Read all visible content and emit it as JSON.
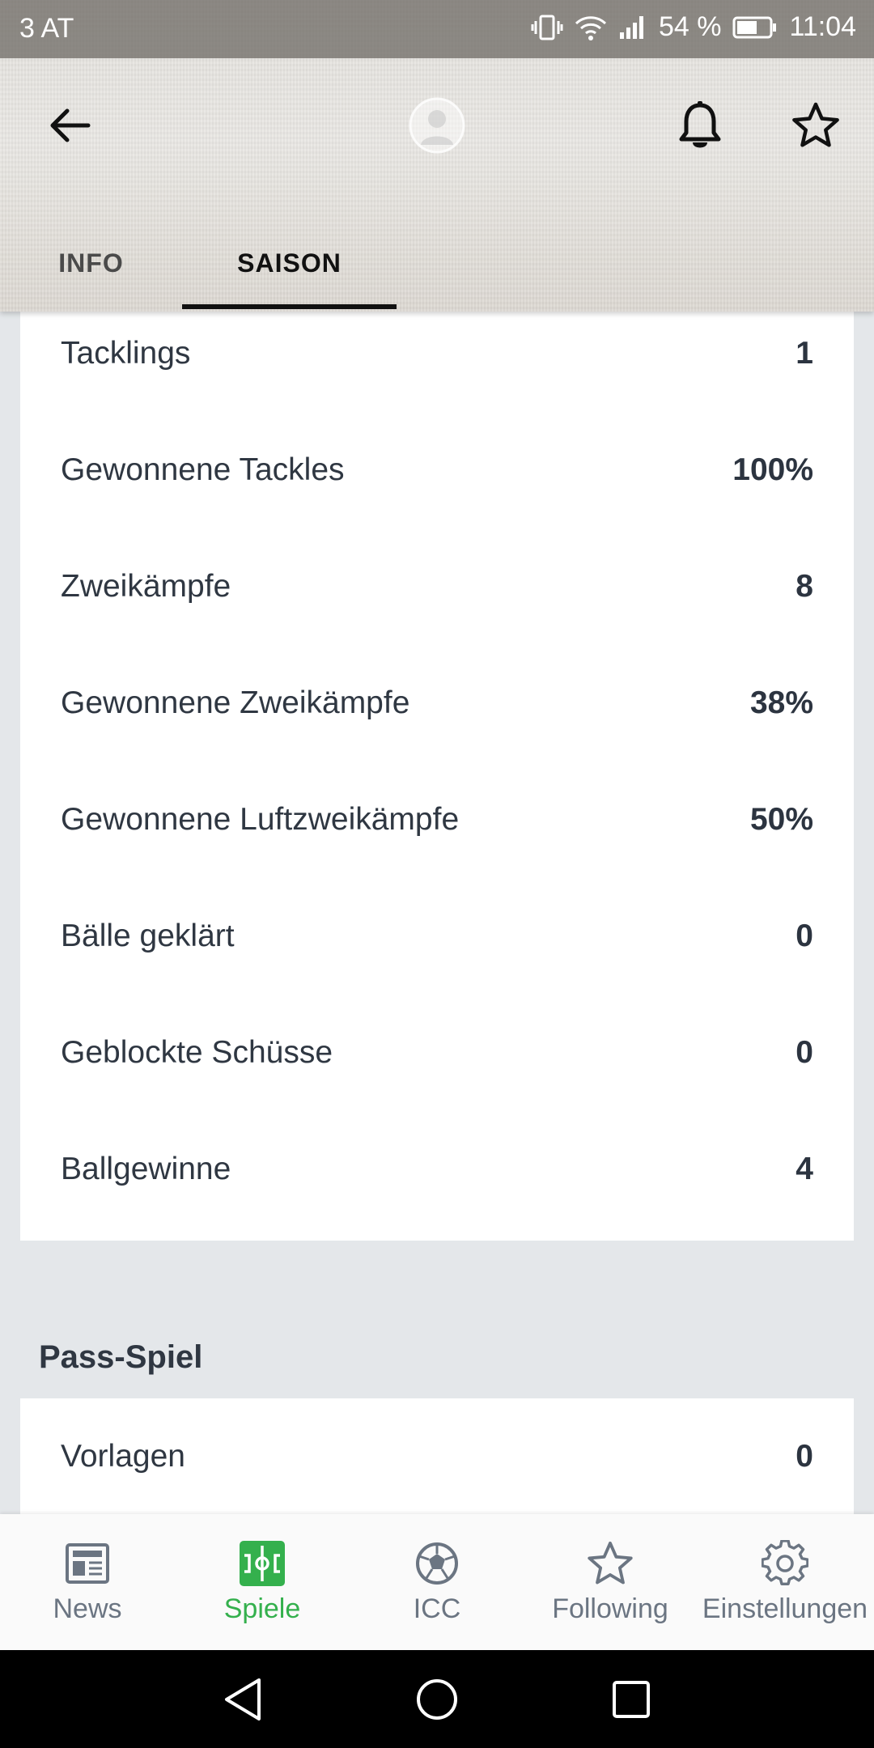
{
  "status_bar": {
    "carrier": "3 AT",
    "battery": "54 %",
    "time": "11:04"
  },
  "tabs": [
    {
      "label": "INFO",
      "active": false
    },
    {
      "label": "SAISON",
      "active": true
    }
  ],
  "stats": [
    {
      "label": "Tacklings",
      "value": "1"
    },
    {
      "label": "Gewonnene Tackles",
      "value": "100%"
    },
    {
      "label": "Zweikämpfe",
      "value": "8"
    },
    {
      "label": "Gewonnene Zweikämpfe",
      "value": "38%"
    },
    {
      "label": "Gewonnene Luftzweikämpfe",
      "value": "50%"
    },
    {
      "label": "Bälle geklärt",
      "value": "0"
    },
    {
      "label": "Geblockte Schüsse",
      "value": "0"
    },
    {
      "label": "Ballgewinne",
      "value": "4"
    }
  ],
  "pass_section": {
    "title": "Pass-Spiel",
    "rows": [
      {
        "label": "Vorlagen",
        "value": "0"
      }
    ]
  },
  "bottom_nav": [
    {
      "label": "News",
      "icon": "newspaper-icon",
      "active": false
    },
    {
      "label": "Spiele",
      "icon": "pitch-icon",
      "active": true
    },
    {
      "label": "ICC",
      "icon": "ball-icon",
      "active": false
    },
    {
      "label": "Following",
      "icon": "star-icon",
      "active": false
    },
    {
      "label": "Einstellungen",
      "icon": "gear-icon",
      "active": false
    }
  ],
  "colors": {
    "accent_active": "#34b04d",
    "nav_inactive": "#6b7582",
    "background": "#e4e7ea"
  }
}
